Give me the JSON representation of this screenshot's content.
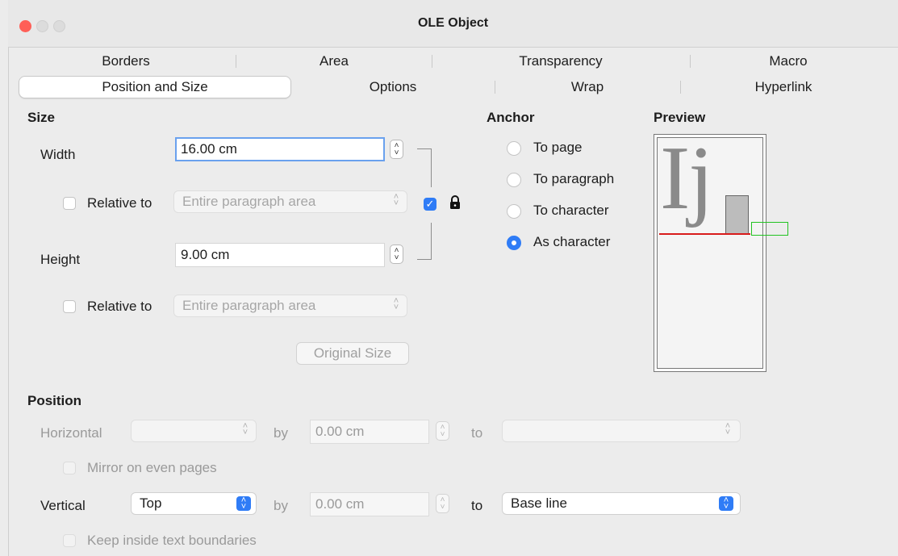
{
  "window": {
    "title": "OLE Object"
  },
  "tabs": {
    "row1": [
      "Borders",
      "Area",
      "Transparency",
      "Macro"
    ],
    "row2": [
      "Position and Size",
      "Options",
      "Wrap",
      "Hyperlink"
    ],
    "selected": "Position and Size"
  },
  "size": {
    "heading": "Size",
    "width_label": "Width",
    "width_value": "16.00 cm",
    "relative_label": "Relative to",
    "relative_value": "Entire paragraph area",
    "height_label": "Height",
    "height_value": "9.00 cm",
    "relative2_label": "Relative to",
    "relative2_value": "Entire paragraph area",
    "keep_ratio_checked": true,
    "original_size_button": "Original Size"
  },
  "anchor": {
    "heading": "Anchor",
    "options": [
      "To page",
      "To paragraph",
      "To character",
      "As character"
    ],
    "selected": "As character"
  },
  "preview": {
    "heading": "Preview",
    "sample_text": "Ij"
  },
  "position": {
    "heading": "Position",
    "horizontal_label": "Horizontal",
    "horizontal_value": "",
    "by_label": "by",
    "horizontal_by_value": "0.00 cm",
    "to_label": "to",
    "horizontal_to_value": "",
    "mirror_label": "Mirror on even pages",
    "vertical_label": "Vertical",
    "vertical_value": "Top",
    "vertical_by_value": "0.00 cm",
    "vertical_to_value": "Base line",
    "keep_inside_label": "Keep inside text boundaries"
  },
  "colors": {
    "accent": "#2f7cf6",
    "close_button": "#ff5f57",
    "preview_baseline": "#d81b1b",
    "preview_frame": "#22c322"
  }
}
